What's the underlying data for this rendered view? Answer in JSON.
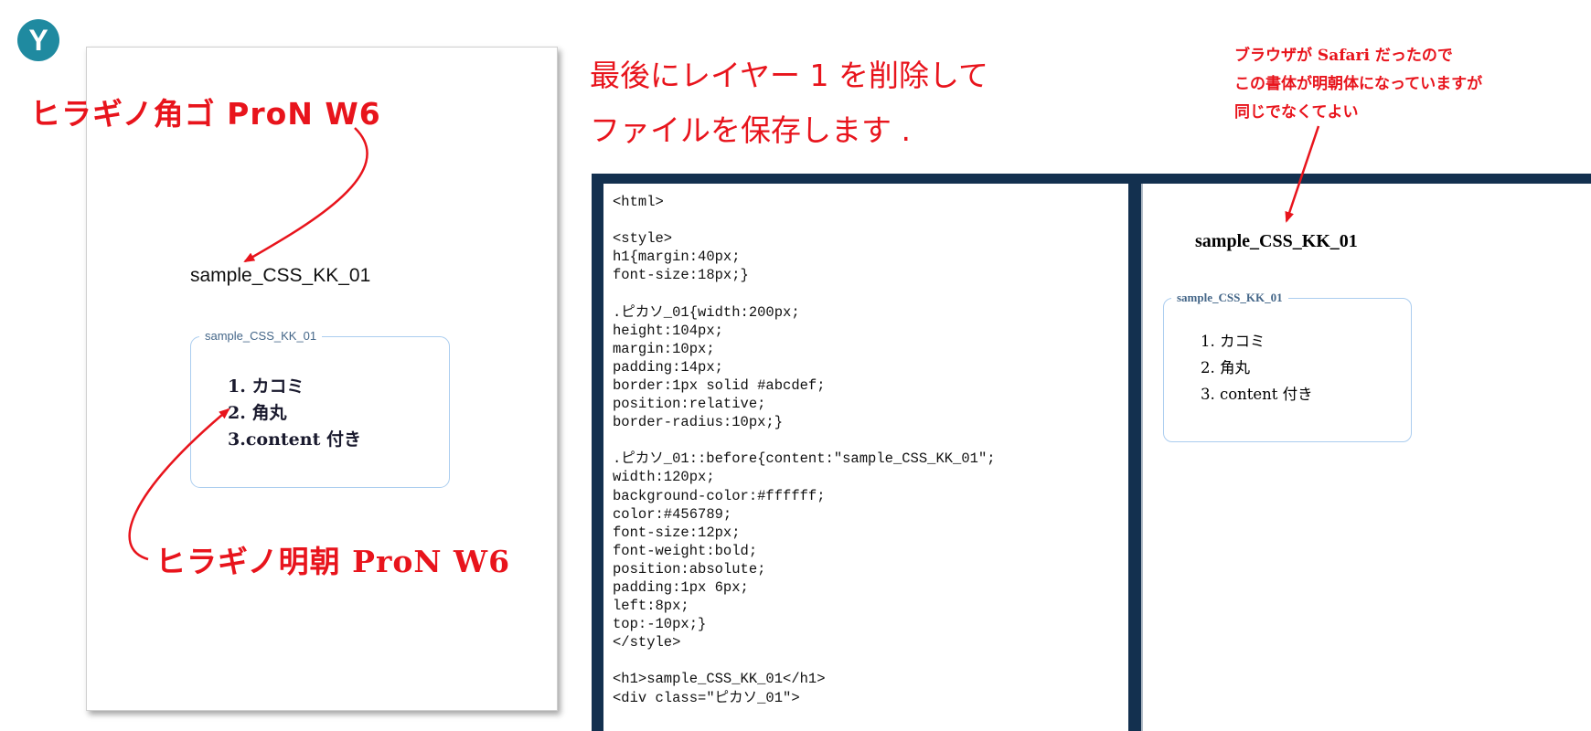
{
  "logo": {
    "letter": "Y"
  },
  "left_page": {
    "heading": "sample_CSS_KK_01",
    "box_label": "sample_CSS_KK_01",
    "list_items": [
      "1. カコミ",
      "2. 角丸",
      "3.content 付き"
    ]
  },
  "annotations": {
    "gothic_font": "ヒラギノ角ゴ ProN W6",
    "mincho_font": "ヒラギノ明朝 ProN W6",
    "instruction_lines": [
      "最後にレイヤー 1 を削除して",
      "ファイルを保存します ."
    ],
    "safari_note_lines": [
      "ブラウザが Safari だったので",
      "この書体が明朝体になっていますが",
      "同じでなくてよい"
    ]
  },
  "code_editor": {
    "lines": [
      "<html>",
      "",
      "<style>",
      "h1{margin:40px;",
      "font-size:18px;}",
      "",
      ".ピカソ_01{width:200px;",
      "height:104px;",
      "margin:10px;",
      "padding:14px;",
      "border:1px solid #abcdef;",
      "position:relative;",
      "border-radius:10px;}",
      "",
      ".ピカソ_01::before{content:\"sample_CSS_KK_01\";",
      "width:120px;",
      "background-color:#ffffff;",
      "color:#456789;",
      "font-size:12px;",
      "font-weight:bold;",
      "position:absolute;",
      "padding:1px 6px;",
      "left:8px;",
      "top:-10px;}",
      "</style>",
      "",
      "<h1>sample_CSS_KK_01</h1>",
      "<div class=\"ピカソ_01\">"
    ]
  },
  "preview": {
    "heading": "sample_CSS_KK_01",
    "box_label": "sample_CSS_KK_01",
    "list_items": [
      "1. カコミ",
      "2. 角丸",
      "3. content 付き"
    ]
  },
  "colors": {
    "annotation_red": "#e8141c",
    "editor_frame": "#13304f",
    "box_border": "#abcdef",
    "box_label": "#456789",
    "logo": "#1f8aa0"
  },
  "icons": {
    "logo": "y-circle-logo"
  }
}
